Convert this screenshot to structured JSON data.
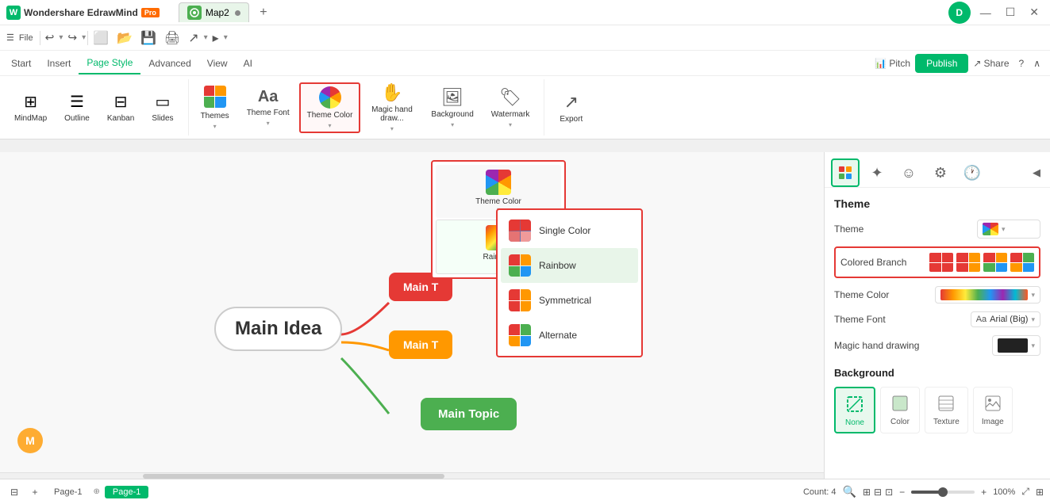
{
  "app": {
    "name": "Wondershare EdrawMind",
    "pro_badge": "Pro",
    "tab_name": "Map2",
    "logo_letter": "W"
  },
  "window_controls": {
    "minimize": "—",
    "maximize": "☐",
    "close": "✕",
    "user_icon": "D"
  },
  "toolbar": {
    "undo": "↩",
    "redo": "↪",
    "items": [
      "⊟",
      "📁",
      "💾",
      "🖨",
      "✏",
      "📋",
      "↩"
    ]
  },
  "main_nav": {
    "items": [
      "Start",
      "Insert",
      "Page Style",
      "Advanced",
      "View",
      "AI"
    ],
    "active": "Page Style",
    "right_items": [
      "Pitch",
      "Publish",
      "Share",
      "?",
      "∧"
    ]
  },
  "ribbon": {
    "groups": [
      {
        "items": [
          {
            "id": "mindmap",
            "icon": "⊞",
            "label": "MindMap"
          },
          {
            "id": "outline",
            "icon": "☰",
            "label": "Outline"
          },
          {
            "id": "kanban",
            "icon": "⊟",
            "label": "Kanban"
          },
          {
            "id": "slides",
            "icon": "▭",
            "label": "Slides"
          }
        ]
      },
      {
        "items": [
          {
            "id": "themes",
            "icon": "⊞",
            "label": "Themes"
          },
          {
            "id": "theme-font",
            "icon": "Aa",
            "label": "Theme Font"
          },
          {
            "id": "theme-color",
            "icon": "🎨",
            "label": "Theme Color",
            "active": true
          },
          {
            "id": "magic-hand",
            "icon": "✋",
            "label": "Magic hand draw..."
          },
          {
            "id": "background",
            "icon": "🖼",
            "label": "Background"
          },
          {
            "id": "watermark",
            "icon": "🏷",
            "label": "Watermark"
          }
        ]
      },
      {
        "items": [
          {
            "id": "export",
            "icon": "↗",
            "label": "Export"
          }
        ]
      }
    ]
  },
  "theme_color_submenu": {
    "items": [
      {
        "id": "theme-color-sub",
        "label": "Theme Color"
      },
      {
        "id": "rainbow",
        "label": "Rainbow",
        "active": true
      }
    ]
  },
  "rainbow_menu": {
    "items": [
      {
        "id": "single-color",
        "label": "Single Color"
      },
      {
        "id": "rainbow",
        "label": "Rainbow",
        "active": true
      },
      {
        "id": "symmetrical",
        "label": "Symmetrical"
      },
      {
        "id": "alternate",
        "label": "Alternate"
      }
    ]
  },
  "canvas": {
    "main_idea": "Main Idea",
    "topics": [
      {
        "id": "topic1",
        "label": "Main T",
        "color": "#e53935"
      },
      {
        "id": "topic2",
        "label": "Main T",
        "color": "#ff9800"
      },
      {
        "id": "topic3",
        "label": "Main Topic",
        "color": "#4caf50"
      }
    ]
  },
  "right_panel": {
    "tabs": [
      {
        "id": "theme-tab",
        "icon": "⊞",
        "active": true
      },
      {
        "id": "sparkle-tab",
        "icon": "✦"
      },
      {
        "id": "emoji-tab",
        "icon": "☺"
      },
      {
        "id": "gear-tab",
        "icon": "⚙"
      },
      {
        "id": "clock-tab",
        "icon": "🕐"
      }
    ],
    "section_title": "Theme",
    "theme_label": "Theme",
    "theme_value": "rainbow",
    "colored_branch_label": "Colored Branch",
    "colored_branch_options": [
      "opt1",
      "opt2",
      "opt3",
      "opt4"
    ],
    "theme_color_label": "Theme Color",
    "theme_font_label": "Theme Font",
    "theme_font_value": "Arial (Big)",
    "magic_drawing_label": "Magic hand drawing",
    "background_section": "Background",
    "bg_options": [
      {
        "id": "none",
        "label": "None",
        "active": true
      },
      {
        "id": "color",
        "label": "Color"
      },
      {
        "id": "texture",
        "label": "Texture"
      },
      {
        "id": "image",
        "label": "Image"
      }
    ]
  },
  "status_bar": {
    "page_add": "+",
    "page1_label": "Page-1",
    "page1_active": false,
    "page2_label": "Page-1",
    "page2_active": true,
    "count_label": "Count: 4",
    "zoom_level": "100%",
    "zoom_in": "+",
    "zoom_out": "−"
  }
}
